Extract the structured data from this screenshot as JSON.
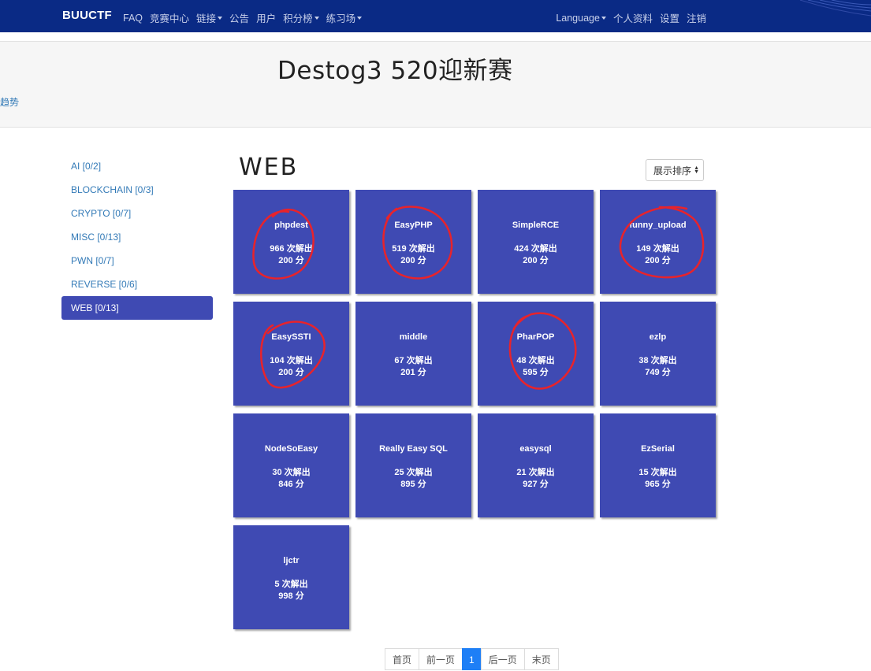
{
  "navbar": {
    "brand": "BUUCTF",
    "left_items": [
      {
        "label": "FAQ",
        "dropdown": false
      },
      {
        "label": "竞赛中心",
        "dropdown": false
      },
      {
        "label": "链接",
        "dropdown": true
      },
      {
        "label": "公告",
        "dropdown": false
      },
      {
        "label": "用户",
        "dropdown": false
      },
      {
        "label": "积分榜",
        "dropdown": true
      },
      {
        "label": "练习场",
        "dropdown": true
      }
    ],
    "right_items": [
      {
        "label": "Language",
        "dropdown": true
      },
      {
        "label": "个人资料",
        "dropdown": false
      },
      {
        "label": "设置",
        "dropdown": false
      },
      {
        "label": "注销",
        "dropdown": false
      }
    ]
  },
  "jumbotron": {
    "title": "Destog3 520迎新赛",
    "trend_link": "趋势"
  },
  "sidebar": {
    "items": [
      {
        "label": "AI [0/2]",
        "active": false
      },
      {
        "label": "BLOCKCHAIN [0/3]",
        "active": false
      },
      {
        "label": "CRYPTO [0/7]",
        "active": false
      },
      {
        "label": "MISC [0/13]",
        "active": false
      },
      {
        "label": "PWN [0/7]",
        "active": false
      },
      {
        "label": "REVERSE [0/6]",
        "active": false
      },
      {
        "label": "WEB [0/13]",
        "active": true
      }
    ]
  },
  "category": {
    "title": "WEB",
    "sort_label": "展示排序"
  },
  "challenges": [
    {
      "name": "phpdest",
      "solves": "966 次解出",
      "points": "200 分",
      "circled": true
    },
    {
      "name": "EasyPHP",
      "solves": "519 次解出",
      "points": "200 分",
      "circled": true
    },
    {
      "name": "SimpleRCE",
      "solves": "424 次解出",
      "points": "200 分",
      "circled": false
    },
    {
      "name": "funny_upload",
      "solves": "149 次解出",
      "points": "200 分",
      "circled": true
    },
    {
      "name": "EasySSTI",
      "solves": "104 次解出",
      "points": "200 分",
      "circled": true
    },
    {
      "name": "middle",
      "solves": "67 次解出",
      "points": "201 分",
      "circled": false
    },
    {
      "name": "PharPOP",
      "solves": "48 次解出",
      "points": "595 分",
      "circled": true
    },
    {
      "name": "ezlp",
      "solves": "38 次解出",
      "points": "749 分",
      "circled": false
    },
    {
      "name": "NodeSoEasy",
      "solves": "30 次解出",
      "points": "846 分",
      "circled": false
    },
    {
      "name": "Really Easy SQL",
      "solves": "25 次解出",
      "points": "895 分",
      "circled": false
    },
    {
      "name": "easysql",
      "solves": "21 次解出",
      "points": "927 分",
      "circled": false
    },
    {
      "name": "EzSerial",
      "solves": "15 次解出",
      "points": "965 分",
      "circled": false
    },
    {
      "name": "ljctr",
      "solves": "5 次解出",
      "points": "998 分",
      "circled": false
    }
  ],
  "pagination": {
    "first": "首页",
    "prev": "前一页",
    "current": "1",
    "next": "后一页",
    "last": "末页"
  },
  "colors": {
    "navbar_bg": "#0a2a85",
    "card_bg": "#3f4ab3",
    "annotation_red": "#e8232b",
    "link": "#337ab7",
    "page_active": "#1e7ff6"
  }
}
